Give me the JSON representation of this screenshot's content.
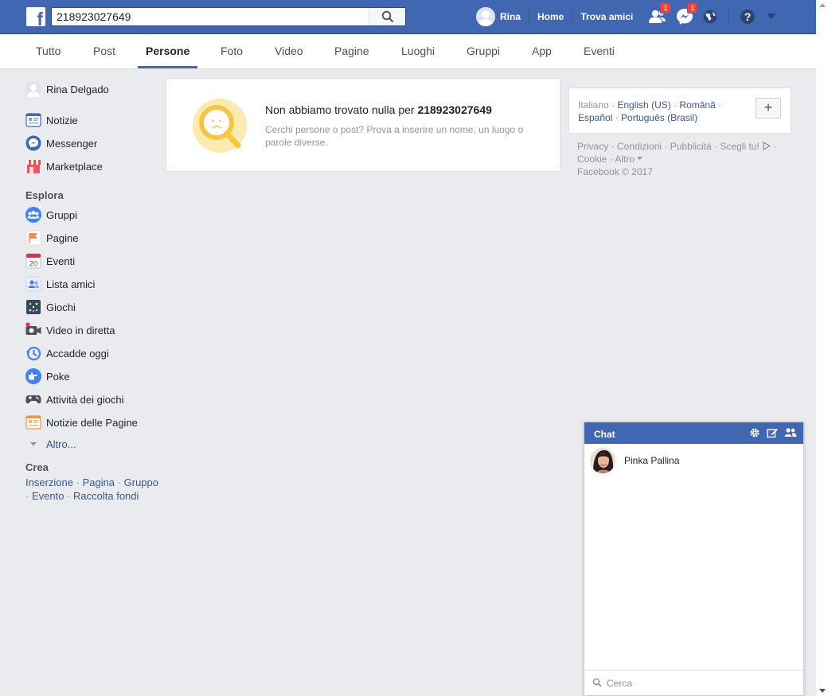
{
  "search": {
    "query": "218923027649"
  },
  "topnav": {
    "user_name": "Rina",
    "home": "Home",
    "find_friends": "Trova amici",
    "friend_requests_count": "1",
    "messages_count": "1"
  },
  "tabs": [
    {
      "label": "Tutto"
    },
    {
      "label": "Post"
    },
    {
      "label": "Persone"
    },
    {
      "label": "Foto"
    },
    {
      "label": "Video"
    },
    {
      "label": "Pagine"
    },
    {
      "label": "Luoghi"
    },
    {
      "label": "Gruppi"
    },
    {
      "label": "App"
    },
    {
      "label": "Eventi"
    }
  ],
  "sidebar": {
    "profile": "Rina Delgado",
    "main": [
      {
        "label": "Notizie"
      },
      {
        "label": "Messenger"
      },
      {
        "label": "Marketplace"
      }
    ],
    "explore_heading": "Esplora",
    "explore": [
      {
        "label": "Gruppi"
      },
      {
        "label": "Pagine"
      },
      {
        "label": "Eventi"
      },
      {
        "label": "Lista amici"
      },
      {
        "label": "Giochi"
      },
      {
        "label": "Video in diretta"
      },
      {
        "label": "Accadde oggi"
      },
      {
        "label": "Poke"
      },
      {
        "label": "Attività dei giochi"
      },
      {
        "label": "Notizie delle Pagine"
      }
    ],
    "more": "Altro...",
    "events_icon_day": "20",
    "create_heading": "Crea",
    "create": [
      {
        "label": "Inserzione"
      },
      {
        "label": "Pagina"
      },
      {
        "label": "Gruppo"
      },
      {
        "label": "Evento"
      },
      {
        "label": "Raccolta fondi"
      }
    ]
  },
  "result": {
    "title_prefix": "Non abbiamo trovato nulla per ",
    "title_query": "218923027649",
    "subtitle": "Cerchi persone o post? Prova a inserire un nome, un luogo o parole diverse."
  },
  "languages": {
    "current": "Italiano",
    "others": [
      "English (US)",
      "Română",
      "Español",
      "Português (Brasil)"
    ],
    "add_label": "+"
  },
  "footer": {
    "links": [
      "Privacy",
      "Condizioni",
      "Pubblicità",
      "Scegli tu!",
      "Cookie",
      "Altro"
    ],
    "copyright": "Facebook © 2017"
  },
  "chat": {
    "title": "Chat",
    "contacts": [
      {
        "name": "Pinka Pallina"
      }
    ],
    "search_placeholder": "Cerca"
  },
  "colors": {
    "brand_blue": "#4267b2",
    "badge_red": "#fa3e3e",
    "link_blue": "#365899",
    "no_result_yellow": "#f7c53f"
  }
}
